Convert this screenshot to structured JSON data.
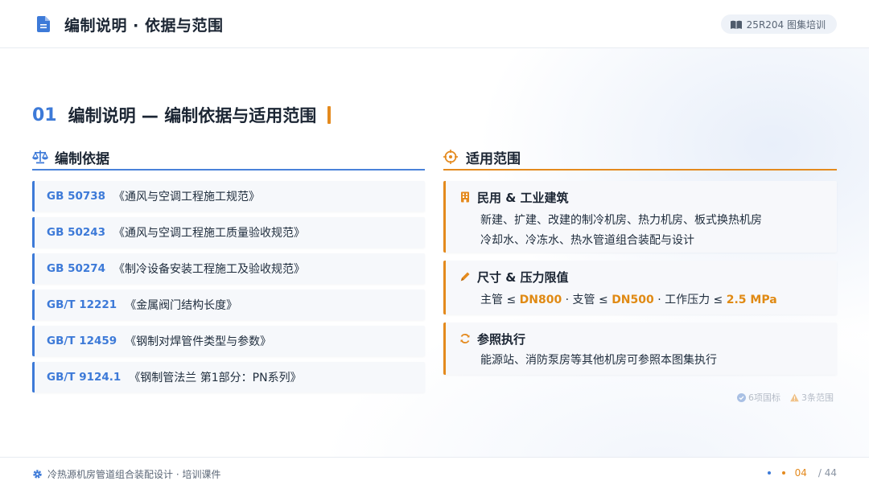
{
  "header": {
    "title": "编制说明 · 依据与范围",
    "course_badge": "25R204 图集培训"
  },
  "section": {
    "number": "01",
    "title": "编制说明 — 编制依据与适用范围"
  },
  "basis": {
    "heading": "编制依据",
    "items": [
      {
        "code": "GB 50738",
        "name": "《通风与空调工程施工规范》"
      },
      {
        "code": "GB 50243",
        "name": "《通风与空调工程施工质量验收规范》"
      },
      {
        "code": "GB 50274",
        "name": "《制冷设备安装工程施工及验收规范》"
      },
      {
        "code": "GB/T 12221",
        "name": "《金属阀门结构长度》"
      },
      {
        "code": "GB/T 12459",
        "name": "《钢制对焊管件类型与参数》"
      },
      {
        "code": "GB/T 9124.1",
        "name": "《钢制管法兰 第1部分：PN系列》"
      }
    ]
  },
  "scope": {
    "heading": "适用范围",
    "cards": {
      "building": {
        "title": "民用 & 工业建筑",
        "line1": "新建、扩建、改建的制冷机房、热力机房、板式换热机房",
        "line2": "冷却水、冷冻水、热水管道组合装配与设计"
      },
      "limits": {
        "title": "尺寸 & 压力限值",
        "main_label": "主管 ≤ ",
        "main_value": "DN800",
        "branch_label": " · 支管 ≤ ",
        "branch_value": "DN500",
        "pressure_label": " · 工作压力 ≤ ",
        "pressure_value": "2.5 MPa"
      },
      "reference": {
        "title": "参照执行",
        "line1": "能源站、消防泵房等其他机房可参照本图集执行"
      }
    }
  },
  "tags": {
    "standards": "6项国标",
    "scopes": "3条范围"
  },
  "footer": {
    "course_name": "冷热源机房管道组合装配设计 · 培训课件",
    "current_page": "04",
    "total_pages": "/ 44"
  },
  "colors": {
    "blue_accent": "#3d7ad8",
    "orange_accent": "#e48a1e"
  }
}
